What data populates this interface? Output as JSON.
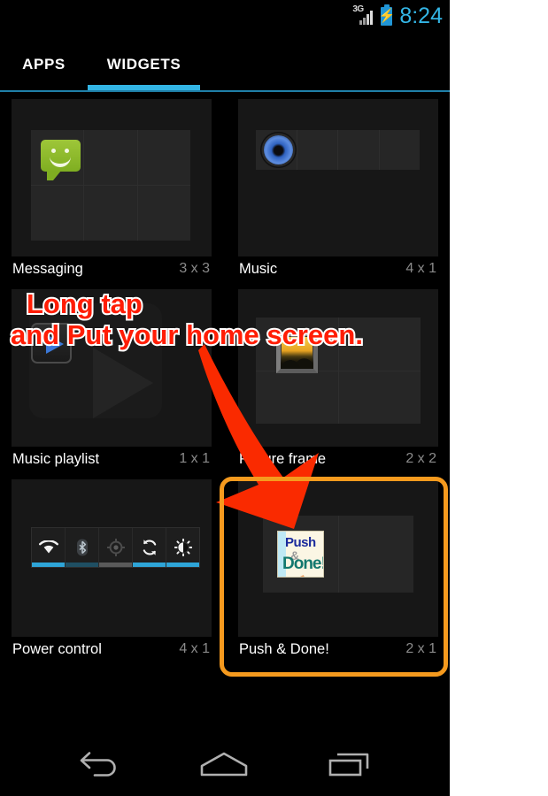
{
  "status_bar": {
    "network_label": "3G",
    "network_icon": "signal-3g-icon",
    "battery_icon": "battery-charging-icon",
    "time": "8:24"
  },
  "tabs": [
    {
      "label": "APPS",
      "selected": false,
      "name": "tab-apps"
    },
    {
      "label": "WIDGETS",
      "selected": true,
      "name": "tab-widgets"
    }
  ],
  "widgets": [
    {
      "label": "Messaging",
      "size": "3 x 3",
      "icon": "messaging-bubble-icon"
    },
    {
      "label": "Music",
      "size": "4 x 1",
      "icon": "music-speaker-icon"
    },
    {
      "label": "Music playlist",
      "size": "1 x 1",
      "icon": "play-button-icon"
    },
    {
      "label": "Picture frame",
      "size": "2 x 2",
      "icon": "picture-frame-icon"
    },
    {
      "label": "Power control",
      "size": "4 x 1",
      "icon": "power-control-icon"
    },
    {
      "label": "Push & Done!",
      "size": "2 x 1",
      "icon": "push-and-done-icon"
    }
  ],
  "power_control": {
    "toggles": [
      {
        "name": "wifi-toggle",
        "state": "on"
      },
      {
        "name": "bluetooth-toggle",
        "state": "dim"
      },
      {
        "name": "gps-toggle",
        "state": "off"
      },
      {
        "name": "sync-toggle",
        "state": "on"
      },
      {
        "name": "brightness-toggle",
        "state": "on"
      }
    ]
  },
  "push_done_icon": {
    "top_word": "Push",
    "amp": "&",
    "bottom_word": "Done!"
  },
  "annotation": {
    "line1": "Long tap",
    "line2": "and Put your home screen.",
    "arrow": "red-curved-arrow",
    "highlight_target": "Push & Done!"
  },
  "nav_bar": [
    {
      "name": "nav-back-button",
      "icon": "back-arrow-icon"
    },
    {
      "name": "nav-home-button",
      "icon": "home-icon"
    },
    {
      "name": "nav-recents-button",
      "icon": "recent-apps-icon"
    }
  ],
  "colors": {
    "accent_blue": "#33b5e5",
    "annotation_red": "#ff1d05",
    "highlight_orange": "#f59a1e",
    "screen_bg": "#000000",
    "preview_bg": "#171717"
  }
}
